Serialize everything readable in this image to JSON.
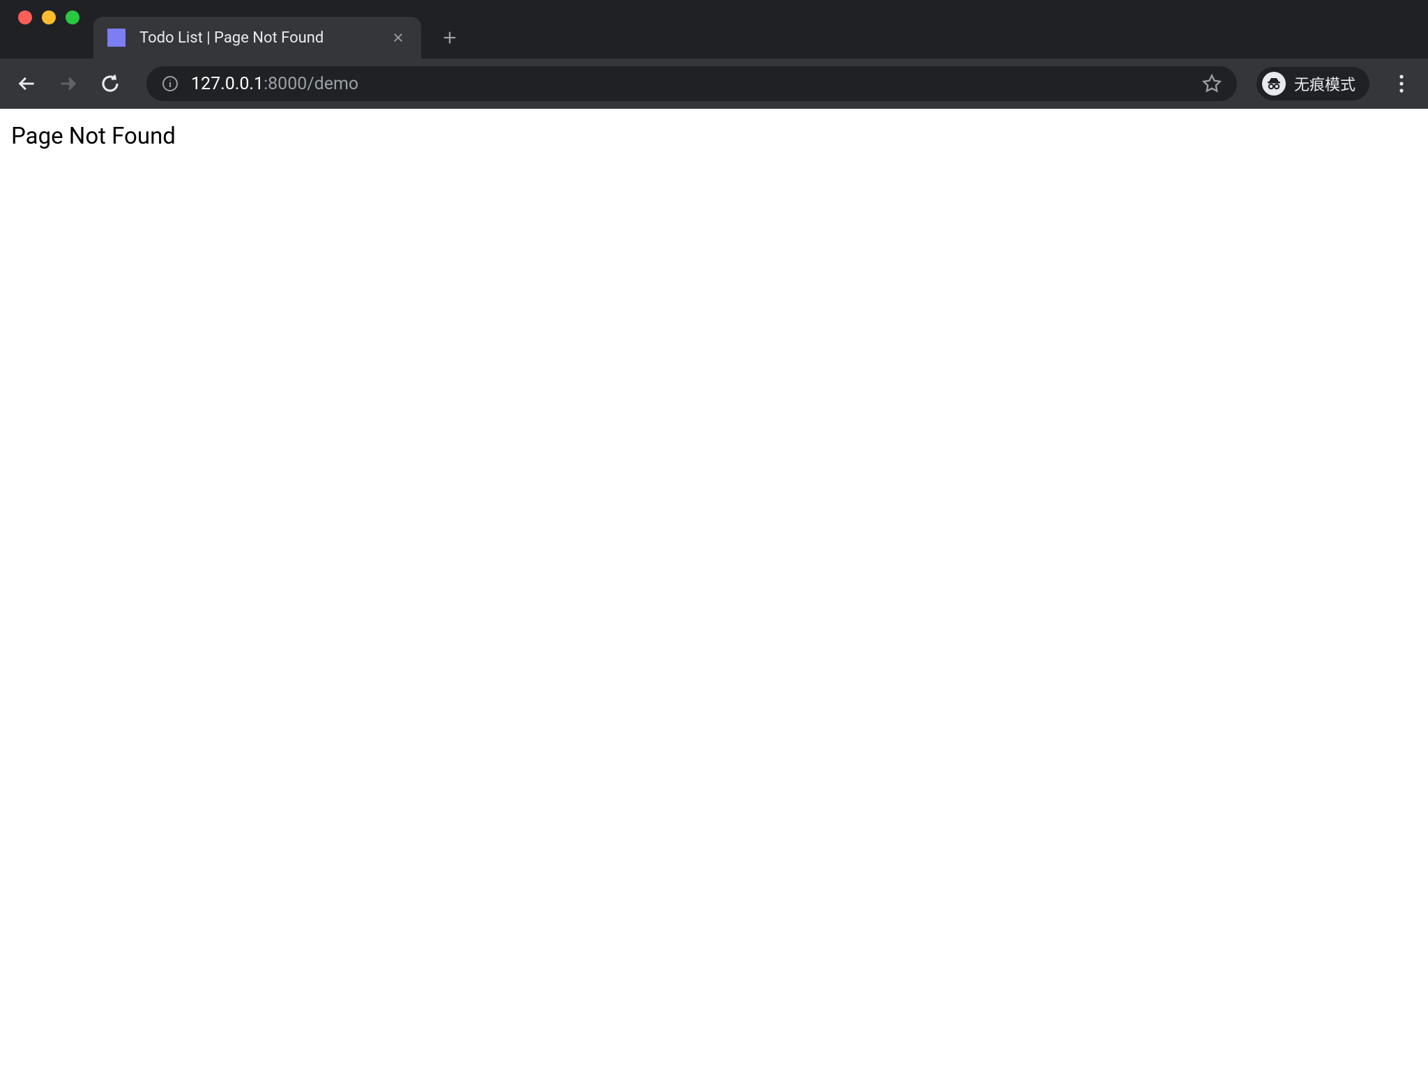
{
  "browser": {
    "tab": {
      "title": "Todo List | Page Not Found",
      "favicon_color": "#7b7ef5"
    },
    "address": {
      "host": "127.0.0.1",
      "port_path": ":8000/demo"
    },
    "incognito_label": "无痕模式"
  },
  "page": {
    "message": "Page Not Found"
  }
}
